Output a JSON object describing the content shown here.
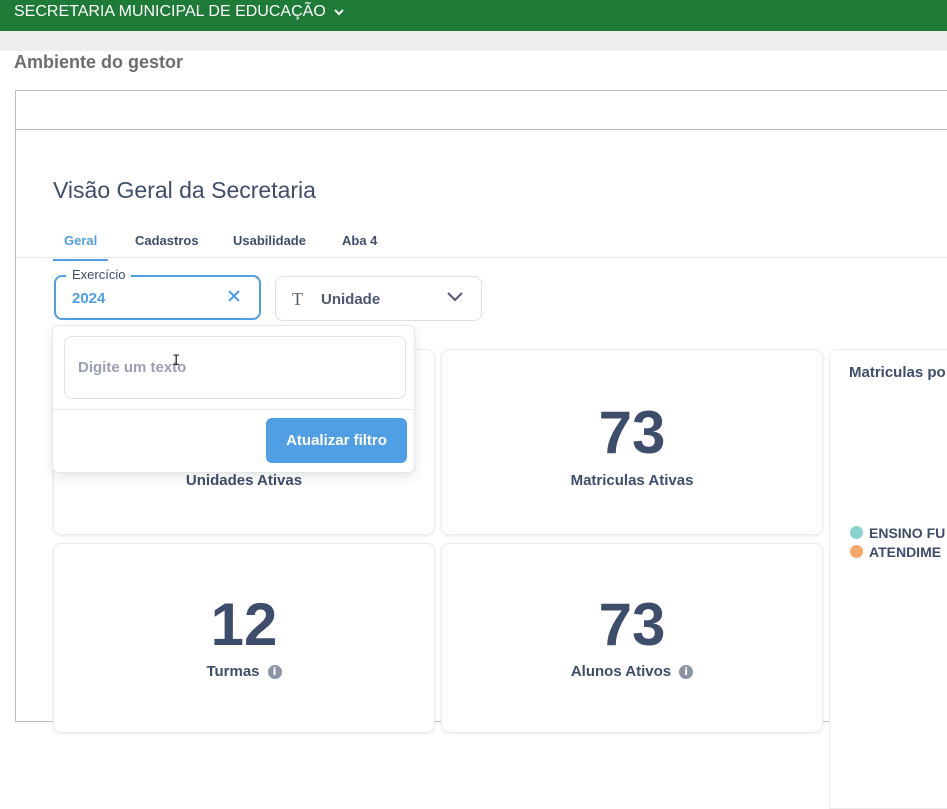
{
  "topbar": {
    "org_name": "SECRETARIA MUNICIPAL DE EDUCAÇÃO",
    "bg_color": "#1e7a37"
  },
  "page": {
    "title": "Ambiente do gestor"
  },
  "dashboard": {
    "title": "Visão Geral da Secretaria",
    "tabs": [
      {
        "label": "Geral",
        "active": true
      },
      {
        "label": "Cadastros",
        "active": false
      },
      {
        "label": "Usabilidade",
        "active": false
      },
      {
        "label": "Aba 4",
        "active": false
      }
    ],
    "filters": {
      "exercicio": {
        "label": "Exercício",
        "value": "2024"
      },
      "unidade": {
        "label": "Unidade"
      }
    },
    "popover": {
      "placeholder": "Digite um texto",
      "button_label": "Atualizar filtro"
    },
    "cards": [
      {
        "label": "Unidades Ativas"
      },
      {
        "value": "73",
        "label": "Matriculas Ativas"
      },
      {
        "value": "12",
        "label": "Turmas"
      },
      {
        "value": "73",
        "label": "Alunos Ativos"
      }
    ],
    "side_panel": {
      "title": "Matriculas po",
      "legend": [
        {
          "label": "ENSINO FU",
          "color": "#88d3cf"
        },
        {
          "label": "ATENDIME",
          "color": "#f2a869"
        }
      ]
    }
  },
  "accent_color": "#509ee3"
}
